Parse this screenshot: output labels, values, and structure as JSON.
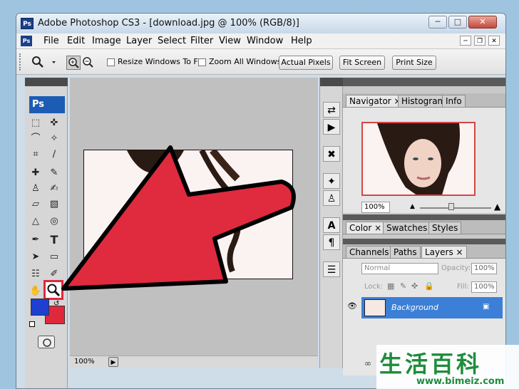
{
  "window": {
    "app_icon": "Ps",
    "title": "Adobe Photoshop CS3 - [download.jpg @ 100% (RGB/8)]",
    "controls": {
      "minimize": "─",
      "restore": "□",
      "close": "✕"
    }
  },
  "menubar": {
    "app_icon": "Ps",
    "items": [
      "File",
      "Edit",
      "Image",
      "Layer",
      "Select",
      "Filter",
      "View",
      "Window",
      "Help"
    ],
    "doc_controls": {
      "minimize": "─",
      "restore": "❐",
      "close": "✕"
    }
  },
  "options": {
    "resize_windows_label": "Resize Windows To Fit",
    "zoom_all_label": "Zoom All Windows",
    "actual_pixels": "Actual Pixels",
    "fit_screen": "Fit Screen",
    "print_size": "Print Size"
  },
  "toolbox": {
    "logo": "Ps",
    "highlighted_tool": "zoom-tool"
  },
  "canvas": {
    "zoom": "100%"
  },
  "navigator": {
    "tabs": [
      "Navigator",
      "Histogram",
      "Info"
    ],
    "zoom": "100%"
  },
  "color_panel": {
    "tabs": [
      "Color",
      "Swatches",
      "Styles"
    ]
  },
  "layers_panel": {
    "tabs": [
      "Channels",
      "Paths",
      "Layers"
    ],
    "blend_mode": "Normal",
    "opacity_label": "Opacity:",
    "opacity": "100%",
    "lock_label": "Lock:",
    "fill_label": "Fill:",
    "fill": "100%",
    "layer_name": "Background"
  },
  "watermark": {
    "chinese": "生活百科",
    "url": "www.bimeiz.com"
  },
  "colors": {
    "foreground": "#1e3fd0",
    "background": "#e0283c",
    "arrow": "#e02a3e",
    "layer_selected": "#3c7fd6"
  }
}
